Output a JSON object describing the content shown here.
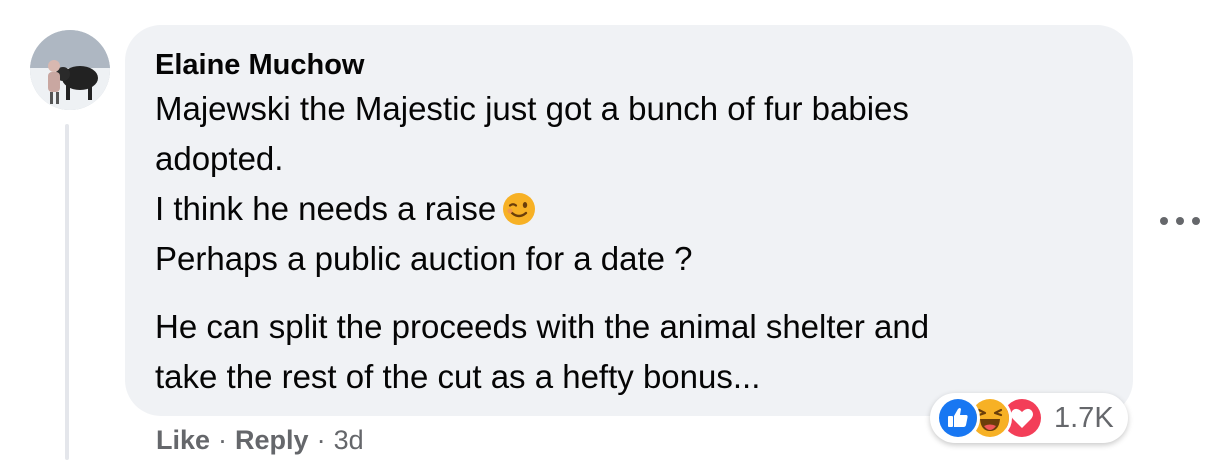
{
  "comment": {
    "author": "Elaine Muchow",
    "lines": [
      "Majewski the Majestic just got a bunch of fur babies",
      "adopted.",
      "I think he needs a raise",
      "Perhaps a public auction for a date ?"
    ],
    "lines2": [
      "He can split the proceeds with the animal shelter and",
      "take the rest of the cut as a hefty bonus..."
    ],
    "emoji": "winking-face-icon"
  },
  "reactions": {
    "icons": [
      "like-reaction-icon",
      "haha-reaction-icon",
      "love-reaction-icon"
    ],
    "count": "1.7K"
  },
  "actions": {
    "like": "Like",
    "reply": "Reply",
    "separator": "·",
    "time": "3d"
  },
  "menu": {
    "icon": "more-options-icon"
  },
  "colors": {
    "bubble": "#f0f2f5",
    "text": "#050505",
    "secondary": "#65676b",
    "like_blue": "#1877f2",
    "love_red": "#f33e58",
    "haha_yellow": "#f7b125"
  }
}
